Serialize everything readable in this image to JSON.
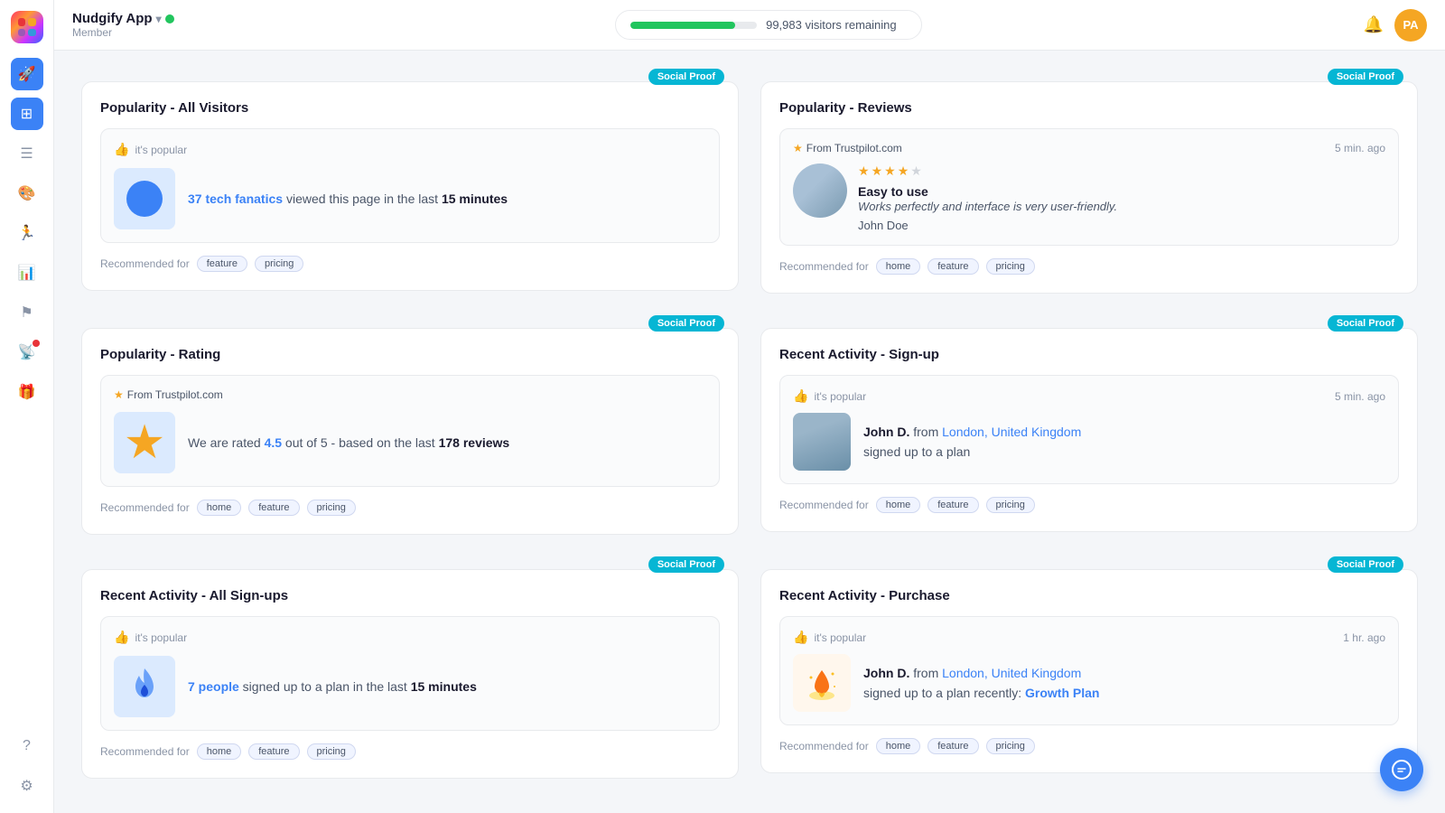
{
  "app": {
    "name": "Nudgify App",
    "chevron": "▾",
    "status": "active",
    "sub_label": "Member"
  },
  "topbar": {
    "visitor_text": "99,983 visitors remaining",
    "visitor_percent": 83,
    "bell_label": "🔔",
    "avatar_initials": "PA"
  },
  "sidebar": {
    "icons": [
      {
        "id": "rocket",
        "symbol": "🚀",
        "active": false
      },
      {
        "id": "widget",
        "symbol": "⊞",
        "active": true
      },
      {
        "id": "list",
        "symbol": "☰",
        "active": false
      },
      {
        "id": "palette",
        "symbol": "🎨",
        "active": false
      },
      {
        "id": "person",
        "symbol": "🏃",
        "active": false
      },
      {
        "id": "chart",
        "symbol": "📊",
        "active": false
      },
      {
        "id": "flag",
        "symbol": "⚑",
        "active": false
      },
      {
        "id": "broadcast",
        "symbol": "📡",
        "active": false,
        "dot": true
      },
      {
        "id": "gift",
        "symbol": "🎁",
        "active": false
      }
    ],
    "bottom_icons": [
      {
        "id": "help",
        "symbol": "?",
        "active": false
      },
      {
        "id": "settings",
        "symbol": "⚙",
        "active": false
      }
    ]
  },
  "social_proof_badge": "Social Proof",
  "cards": [
    {
      "id": "popularity-all-visitors",
      "title": "Popularity - All Visitors",
      "badge": "Social Proof",
      "preview": {
        "popular_label": "it's popular",
        "has_thumb": true,
        "image_type": "blue-circle",
        "text_part1": "37 tech fanatics",
        "text_part2": " viewed this page in the last ",
        "text_bold": "15 minutes"
      },
      "recommended_for": [
        "feature",
        "pricing"
      ]
    },
    {
      "id": "popularity-reviews",
      "title": "Popularity - Reviews",
      "badge": "Social Proof",
      "preview": {
        "source": "From Trustpilot.com",
        "time_ago": "5 min. ago",
        "stars": 4,
        "max_stars": 5,
        "review_title": "Easy to use",
        "review_text": "Works perfectly and interface is very user-friendly.",
        "reviewer": "John Doe",
        "image_type": "person"
      },
      "recommended_for": [
        "home",
        "feature",
        "pricing"
      ]
    },
    {
      "id": "popularity-rating",
      "title": "Popularity - Rating",
      "badge": "Social Proof",
      "preview": {
        "source": "From Trustpilot.com",
        "has_thumb": false,
        "image_type": "star",
        "rating_value": "4.5",
        "rating_text1": "We are rated ",
        "rating_highlight": "4.5",
        "rating_text2": " out of 5 - based on the last ",
        "rating_bold": "178 reviews"
      },
      "recommended_for": [
        "home",
        "feature",
        "pricing"
      ]
    },
    {
      "id": "recent-activity-signup",
      "title": "Recent Activity - Sign-up",
      "badge": "Social Proof",
      "preview": {
        "popular_label": "it's popular",
        "time_ago": "5 min. ago",
        "image_type": "person",
        "name": "John D.",
        "from_text": " from ",
        "location": "London, United Kingdom",
        "action": "signed up to a plan"
      },
      "recommended_for": [
        "home",
        "feature",
        "pricing"
      ]
    },
    {
      "id": "recent-activity-all-signups",
      "title": "Recent Activity - All Sign-ups",
      "badge": "Social Proof",
      "preview": {
        "popular_label": "it's popular",
        "has_thumb": true,
        "image_type": "fire",
        "text_part1": "7 people",
        "text_part2": " signed up to a plan in the last ",
        "text_bold": "15 minutes"
      },
      "recommended_for": [
        "home",
        "feature",
        "pricing"
      ]
    },
    {
      "id": "recent-activity-purchase",
      "title": "Recent Activity - Purchase",
      "badge": "Social Proof",
      "preview": {
        "popular_label": "it's popular",
        "time_ago": "1 hr. ago",
        "image_type": "rocket",
        "name": "John D.",
        "from_text": " from ",
        "location": "London, United Kingdom",
        "action": "signed up to a plan recently: ",
        "plan": "Growth Plan"
      },
      "recommended_for": [
        "home",
        "feature",
        "pricing"
      ]
    }
  ]
}
